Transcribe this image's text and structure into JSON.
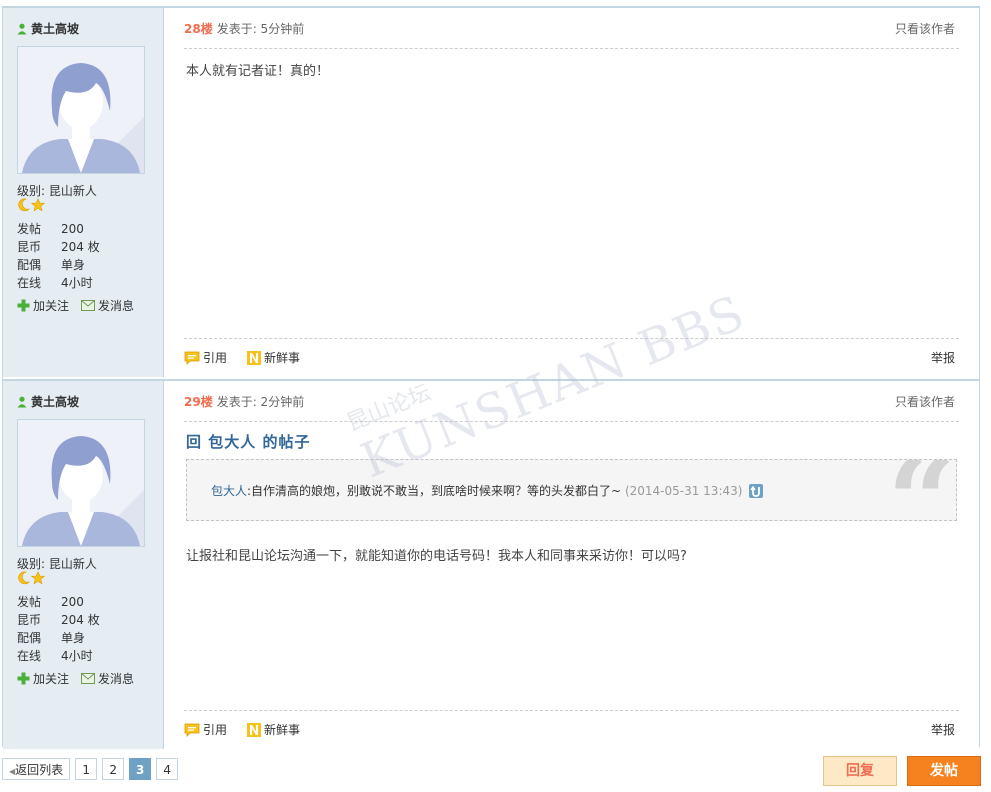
{
  "posts": [
    {
      "author": "黄土高坡",
      "level_label": "级别:",
      "level": "昆山新人",
      "stats": [
        {
          "k": "发帖",
          "v": "200"
        },
        {
          "k": "昆币",
          "v": "204 枚"
        },
        {
          "k": "配偶",
          "v": "单身"
        },
        {
          "k": "在线",
          "v": "4小时"
        }
      ],
      "follow": "加关注",
      "message": "发消息",
      "floor": "28楼",
      "posted": "发表于: 5分钟前",
      "only_author": "只看该作者",
      "body": "本人就有记者证！真的！",
      "quote_btn": "引用",
      "fresh_btn": "新鲜事",
      "report": "举报"
    },
    {
      "author": "黄土高坡",
      "level_label": "级别:",
      "level": "昆山新人",
      "stats": [
        {
          "k": "发帖",
          "v": "200"
        },
        {
          "k": "昆币",
          "v": "204 枚"
        },
        {
          "k": "配偶",
          "v": "单身"
        },
        {
          "k": "在线",
          "v": "4小时"
        }
      ],
      "follow": "加关注",
      "message": "发消息",
      "floor": "29楼",
      "posted": "发表于: 2分钟前",
      "only_author": "只看该作者",
      "reply_title": "回 包大人 的帖子",
      "quote_user": "包大人",
      "quote_text": ":自作清高的娘炮，别敢说不敢当，到底啥时候来啊？等的头发都白了~ ",
      "quote_date": "(2014-05-31 13:43)",
      "body": "让报社和昆山论坛沟通一下，就能知道你的电话号码！我本人和同事来采访你！可以吗?",
      "quote_btn": "引用",
      "fresh_btn": "新鲜事",
      "report": "举报"
    }
  ],
  "watermark": {
    "line1": "昆山论坛",
    "line2": "KUNSHAN BBS"
  },
  "pager": {
    "back": "返回列表",
    "pages": [
      "1",
      "2",
      "3",
      "4"
    ],
    "current": "3"
  },
  "buttons": {
    "reply": "回复",
    "post": "发帖"
  },
  "colors": {
    "accent": "#f5821f",
    "border": "#c2d5e3",
    "sidebar": "#e5edf2",
    "link": "#336699",
    "floor": "#f26c4f"
  }
}
